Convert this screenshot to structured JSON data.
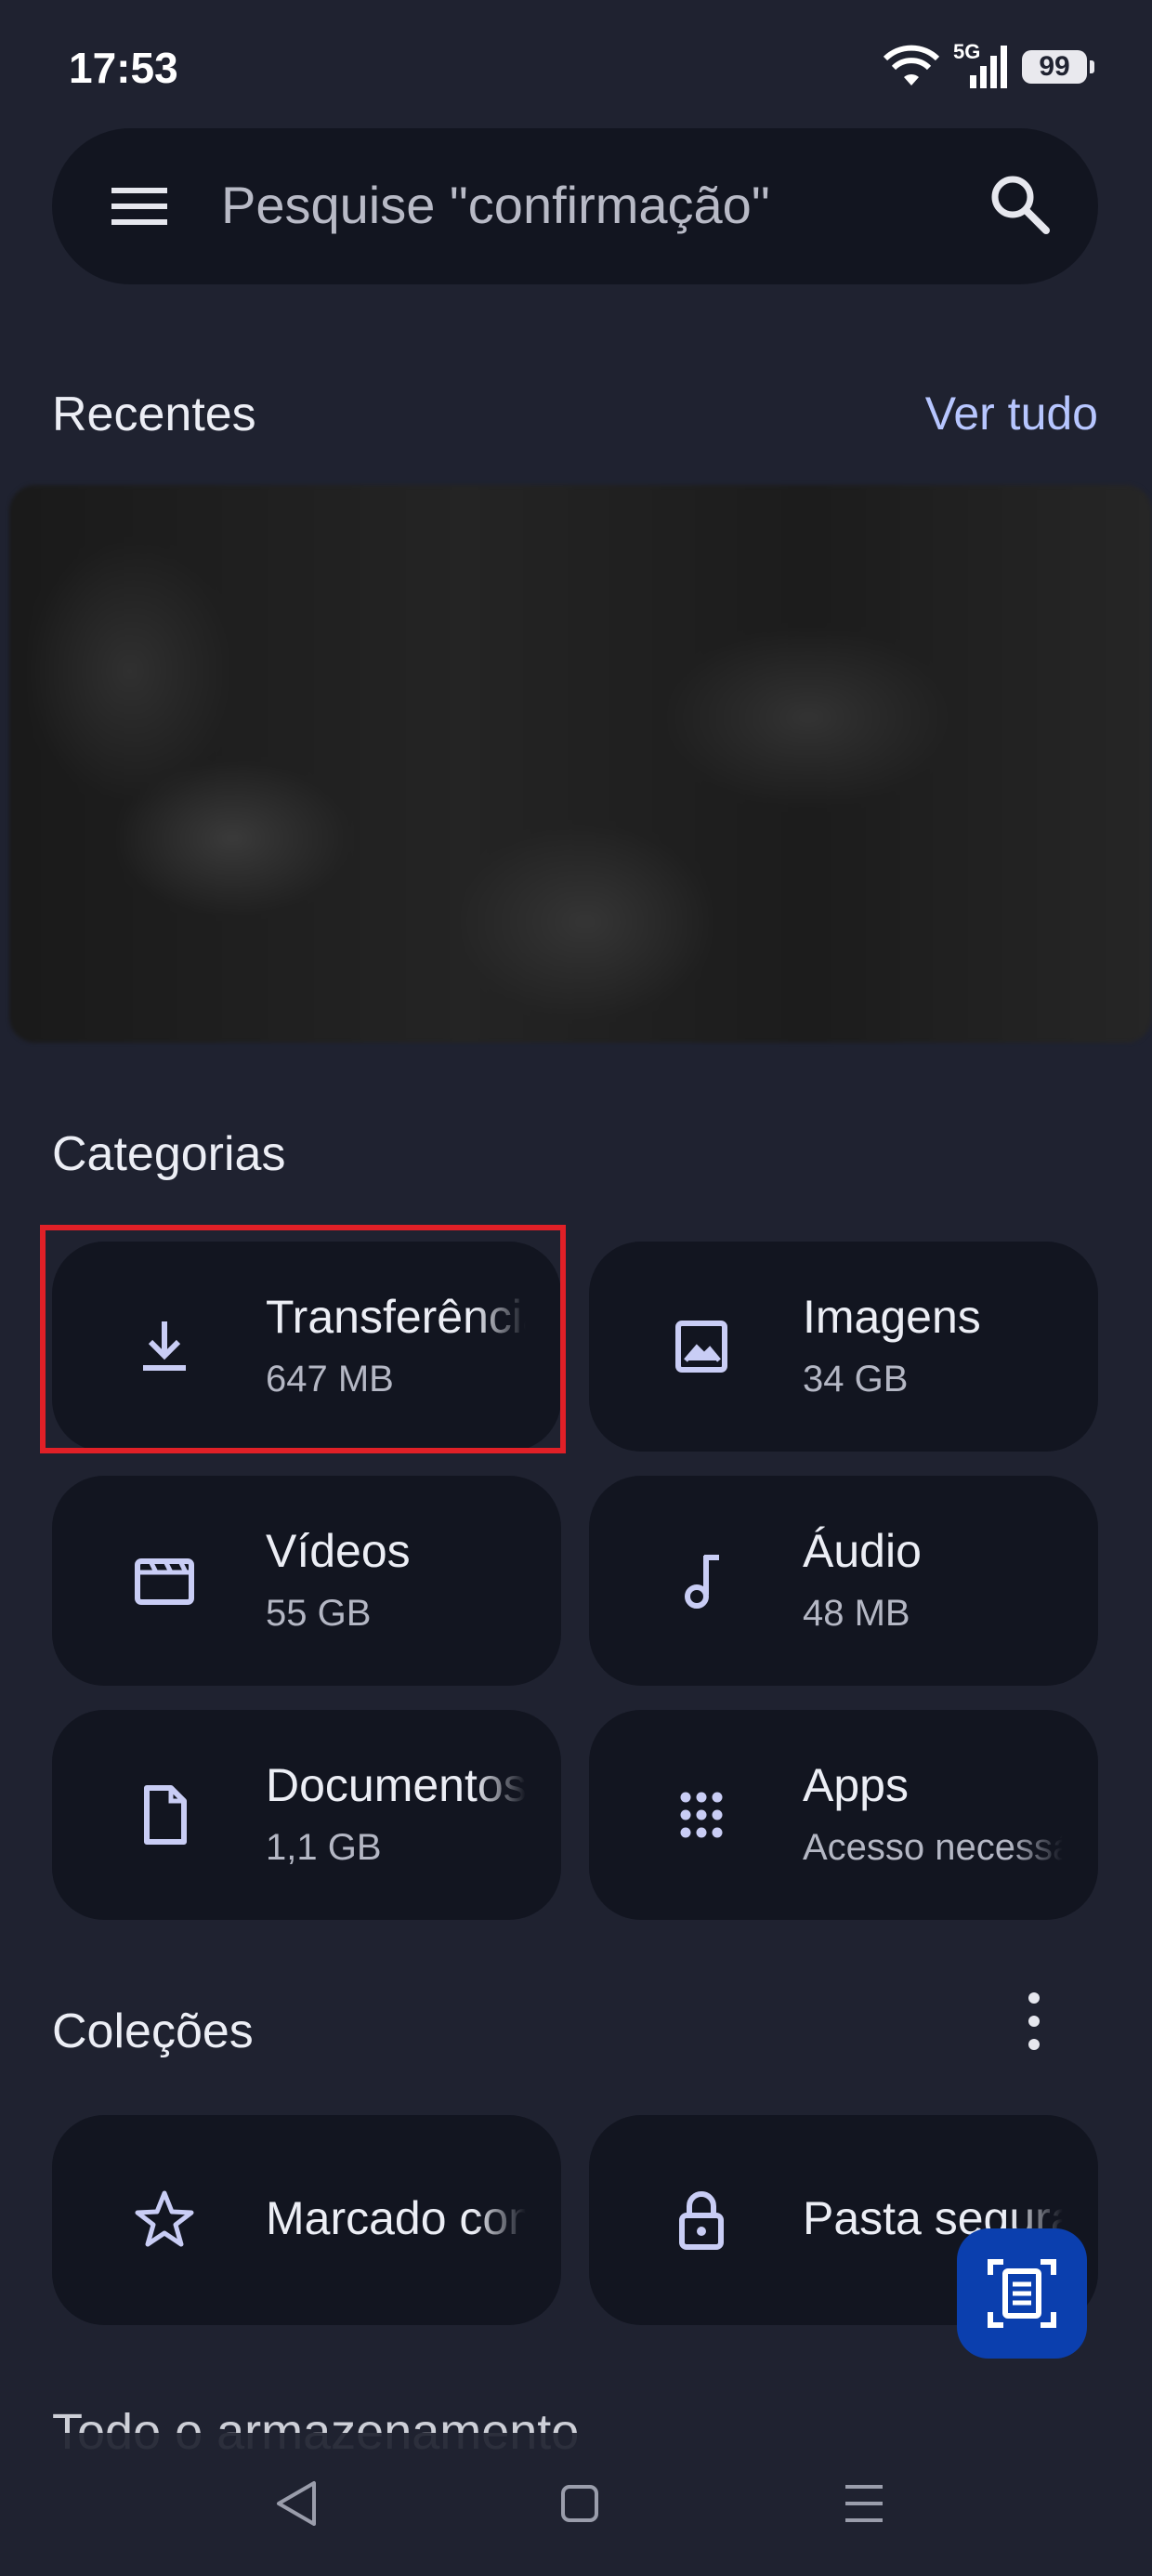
{
  "status_bar": {
    "time": "17:53",
    "network_label": "5G",
    "battery": "99"
  },
  "search": {
    "placeholder": "Pesquise \"confirmação\""
  },
  "recents": {
    "title": "Recentes",
    "see_all": "Ver tudo"
  },
  "categories": {
    "title": "Categorias",
    "items": [
      {
        "name": "Transferências",
        "detail": "647 MB",
        "icon": "download-icon"
      },
      {
        "name": "Imagens",
        "detail": "34 GB",
        "icon": "image-icon"
      },
      {
        "name": "Vídeos",
        "detail": "55 GB",
        "icon": "video-icon"
      },
      {
        "name": "Áudio",
        "detail": "48 MB",
        "icon": "music-note-icon"
      },
      {
        "name": "Documentos",
        "detail": "1,1 GB",
        "icon": "document-icon"
      },
      {
        "name": "Apps",
        "detail": "Acesso necessário",
        "icon": "apps-grid-icon"
      }
    ]
  },
  "collections": {
    "title": "Coleções",
    "items": [
      {
        "name": "Marcado com estrela",
        "icon": "star-icon"
      },
      {
        "name": "Pasta segura",
        "icon": "lock-icon"
      }
    ]
  },
  "storage": {
    "title": "Todo o armazenamento"
  },
  "colors": {
    "background": "#1f2230",
    "card": "#121520",
    "accent_link": "#b7c6ff",
    "icon": "#c9cdf5",
    "fab": "#0b3fae",
    "highlight": "#e02027"
  }
}
